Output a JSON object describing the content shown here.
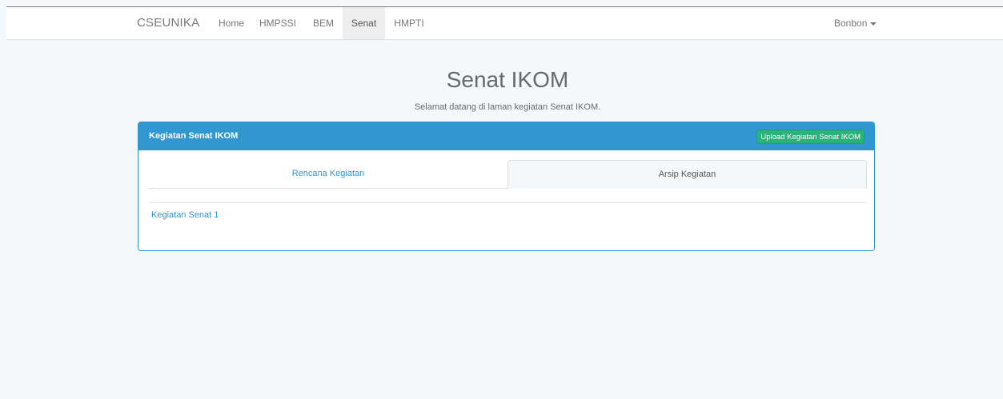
{
  "navbar": {
    "brand": "CSEUNIKA",
    "items": [
      {
        "label": "Home"
      },
      {
        "label": "HMPSSI"
      },
      {
        "label": "BEM"
      },
      {
        "label": "Senat"
      },
      {
        "label": "HMPTI"
      }
    ],
    "active_item": "Senat",
    "user": "Bonbon"
  },
  "page": {
    "title": "Senat IKOM",
    "subtitle": "Selamat datang di laman kegiatan Senat IKOM."
  },
  "panel": {
    "title": "Kegiatan Senat IKOM",
    "upload_button": "Upload Kegiatan Senat IKOM",
    "tabs": [
      {
        "label": "Rencana Kegiatan"
      },
      {
        "label": "Arsip Kegiatan"
      }
    ],
    "items": [
      {
        "label": "Kegiatan Senat 1"
      }
    ]
  },
  "colors": {
    "background": "#f5f8fa",
    "primary": "#3097d1",
    "success": "#2ab27b",
    "text": "#636b6f"
  }
}
